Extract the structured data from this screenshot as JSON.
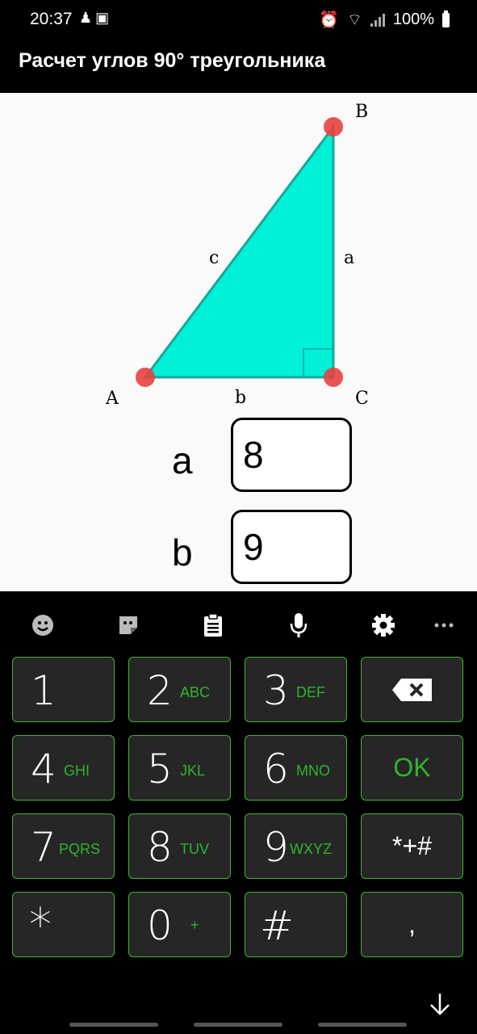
{
  "status_bar": {
    "time": "20:37",
    "left_icons": [
      "person-icon",
      "image-icon"
    ],
    "right_icons": [
      "alarm-icon",
      "wifi-icon",
      "signal-icon"
    ],
    "battery": "100%"
  },
  "app": {
    "title": "Расчет углов 90° треугольника"
  },
  "diagram": {
    "vertices": {
      "a": "A",
      "b": "B",
      "c": "C"
    },
    "sides": {
      "a": "a",
      "b": "b",
      "c": "c"
    },
    "fill_color": "#00f0d8",
    "vertex_color": "#e84040"
  },
  "inputs": {
    "a_label": "a",
    "a_value": "8",
    "b_label": "b",
    "b_value": "9"
  },
  "keyboard": {
    "toolbar": [
      "emoji-icon",
      "sticker-icon",
      "clipboard-icon",
      "microphone-icon",
      "settings-icon",
      "more-icon"
    ],
    "keys": [
      {
        "main": "1",
        "sub": ""
      },
      {
        "main": "2",
        "sub": "ABC"
      },
      {
        "main": "3",
        "sub": "DEF"
      },
      {
        "main": "4",
        "sub": "GHI"
      },
      {
        "main": "5",
        "sub": "JKL"
      },
      {
        "main": "6",
        "sub": "MNO"
      },
      {
        "main": "7",
        "sub": "PQRS"
      },
      {
        "main": "8",
        "sub": "TUV"
      },
      {
        "main": "9",
        "sub": "WXYZ"
      },
      {
        "main": "*",
        "sub": ""
      },
      {
        "main": "0",
        "sub": "+"
      },
      {
        "main": "#",
        "sub": ""
      }
    ],
    "ok": "OK",
    "symbols": "*+#",
    "comma": ",",
    "accent_color": "#2eb52e"
  }
}
